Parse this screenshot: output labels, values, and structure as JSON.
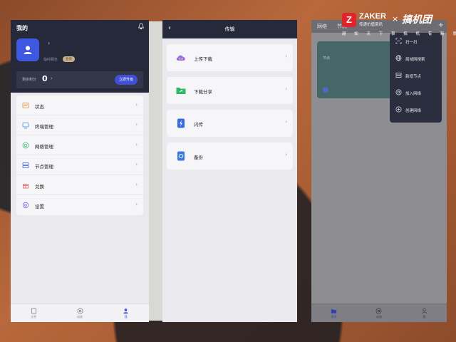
{
  "watermark": {
    "brand": "ZAKER",
    "tagline": "传递价值资讯",
    "partner": "搞机团",
    "slogan": "越 知 天 下 事 搞 机 有 新 意",
    "separator": "×",
    "logo_letter": "Z"
  },
  "profile_screen": {
    "title": "我的",
    "member_label": "临时服务",
    "member_badge": "会员",
    "profile_chevron": "›",
    "points_label": "剩余积分",
    "points_value": "0",
    "points_chevron": "›",
    "upgrade_label": "立即升级",
    "menu": [
      {
        "label": "状态",
        "icon": "status-icon",
        "color": "#e08a3a"
      },
      {
        "label": "终端管理",
        "icon": "terminal-icon",
        "color": "#3a8fe0"
      },
      {
        "label": "网络管理",
        "icon": "network-icon",
        "color": "#3ac07a"
      },
      {
        "label": "节点管理",
        "icon": "node-icon",
        "color": "#3a60e0"
      },
      {
        "label": "兑换",
        "icon": "gift-icon",
        "color": "#e05a5a"
      },
      {
        "label": "设置",
        "icon": "settings-icon",
        "color": "#8a5ae0"
      }
    ],
    "nav": [
      {
        "label": "文件",
        "active": false
      },
      {
        "label": "动态",
        "active": false
      },
      {
        "label": "我",
        "active": true
      }
    ]
  },
  "transfer_screen": {
    "title": "传输",
    "back": "‹",
    "items": [
      {
        "label": "上传下载",
        "icon": "cloud-transfer-icon",
        "color": "#9b6ae0"
      },
      {
        "label": "下载分享",
        "icon": "folder-share-icon",
        "color": "#2fb86a"
      },
      {
        "label": "闪传",
        "icon": "flash-icon",
        "color": "#3a6ae0"
      },
      {
        "label": "备份",
        "icon": "backup-icon",
        "color": "#3a7ae0"
      }
    ]
  },
  "network_screen": {
    "tabs": [
      "网络",
      "节点"
    ],
    "add": "+",
    "card_text": "节点",
    "menu": [
      {
        "label": "扫一扫",
        "icon": "scan-icon"
      },
      {
        "label": "局域网搜索",
        "icon": "lan-search-icon"
      },
      {
        "label": "新增节点",
        "icon": "add-node-icon"
      },
      {
        "label": "加入网络",
        "icon": "join-network-icon"
      },
      {
        "label": "创建网络",
        "icon": "create-network-icon"
      }
    ],
    "nav": [
      {
        "label": "资讯",
        "active": true
      },
      {
        "label": "动态",
        "active": false
      },
      {
        "label": "我",
        "active": false
      }
    ]
  },
  "colors": {
    "header_dark": "#26293a",
    "accent": "#3f4fd8",
    "avatar": "#3e58e0",
    "badge": "#c8b08a"
  }
}
